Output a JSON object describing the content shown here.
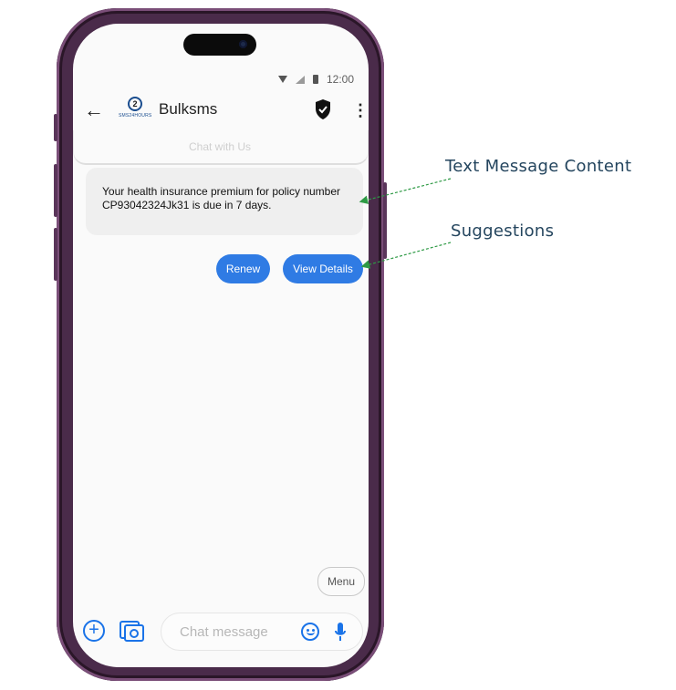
{
  "status_bar": {
    "time": "12:00"
  },
  "app_bar": {
    "back_icon": "arrow-left-icon",
    "logo_letter": "2",
    "logo_text": "SMS24HOURS",
    "title": "Bulksms",
    "verified_icon": "shield-check-icon",
    "more_icon": "more-vert-icon"
  },
  "previous_card": {
    "text": "Chat with Us"
  },
  "message": {
    "text": "Your health insurance premium for policy number CP93042324Jk31 is due in 7 days."
  },
  "suggestions": [
    {
      "label": "Renew"
    },
    {
      "label": "View Details"
    }
  ],
  "menu": {
    "label": "Menu"
  },
  "composer": {
    "add_icon": "add-circle-icon",
    "gallery_icon": "camera-gallery-icon",
    "placeholder": "Chat message",
    "emoji_icon": "emoji-icon",
    "mic_icon": "mic-icon"
  },
  "annotations": [
    {
      "label": "Text Message Content"
    },
    {
      "label": "Suggestions"
    }
  ],
  "colors": {
    "chip": "#2f7be4",
    "accent": "#1a73e8",
    "frame": "#4a2b4a",
    "annotation_arrow": "#2e9a45",
    "annotation_text": "#24455e"
  }
}
